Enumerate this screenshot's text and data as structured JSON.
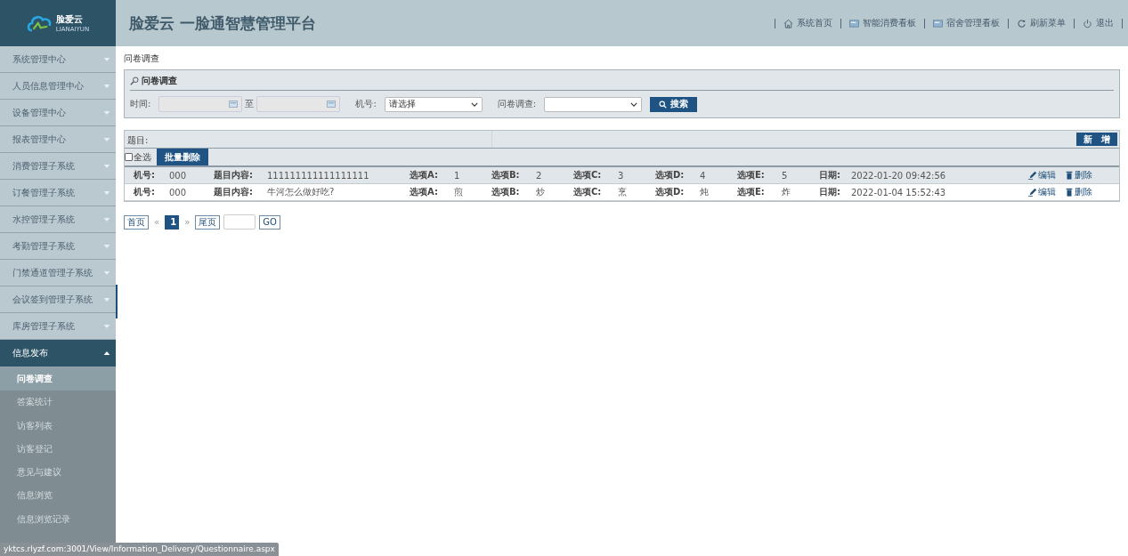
{
  "header": {
    "logo_text": "脸爱云",
    "logo_sub": "LIANAIYUN",
    "title": "脸爱云 一脸通智慧管理平台",
    "nav": [
      {
        "label": "系统首页",
        "kind": "home"
      },
      {
        "label": "智能消费看板",
        "kind": "board"
      },
      {
        "label": "宿舍管理看板",
        "kind": "board"
      },
      {
        "label": "刷新菜单",
        "kind": "refresh"
      },
      {
        "label": "退出",
        "kind": "power"
      }
    ]
  },
  "sidebar": {
    "items": [
      {
        "label": "系统管理中心",
        "expanded": false
      },
      {
        "label": "人员信息管理中心",
        "expanded": false
      },
      {
        "label": "设备管理中心",
        "expanded": false
      },
      {
        "label": "报表管理中心",
        "expanded": false
      },
      {
        "label": "消费管理子系统",
        "expanded": false
      },
      {
        "label": "订餐管理子系统",
        "expanded": false
      },
      {
        "label": "水控管理子系统",
        "expanded": false
      },
      {
        "label": "考勤管理子系统",
        "expanded": false
      },
      {
        "label": "门禁通道管理子系统",
        "expanded": false
      },
      {
        "label": "会议签到管理子系统",
        "expanded": false
      },
      {
        "label": "库房管理子系统",
        "expanded": false
      },
      {
        "label": "信息发布",
        "expanded": true,
        "children": [
          {
            "label": "问卷调查",
            "selected": true
          },
          {
            "label": "答案统计",
            "selected": false
          },
          {
            "label": "访客列表",
            "selected": false
          },
          {
            "label": "访客登记",
            "selected": false
          },
          {
            "label": "意见与建议",
            "selected": false
          },
          {
            "label": "信息浏览",
            "selected": false
          },
          {
            "label": "信息浏览记录",
            "selected": false
          }
        ]
      }
    ]
  },
  "breadcrumb": "问卷调查",
  "search_panel": {
    "title": "问卷调查",
    "time_label": "时间:",
    "to_label": "至",
    "machine_label": "机号:",
    "machine_value": "请选择",
    "survey_label": "问卷调查:",
    "search_button": "搜索"
  },
  "list": {
    "topic_label": "题目:",
    "add_button": "新　增",
    "select_all": {
      "label": "全选",
      "checked": false
    },
    "batch_delete": "批量删除",
    "rows": [
      {
        "highlighted": true,
        "cells": [
          {
            "label": "机号:",
            "value": "000"
          },
          {
            "label": "题目内容:",
            "value": "111111111111111111"
          },
          {
            "label": "选项A:",
            "value": "1"
          },
          {
            "label": "选项B:",
            "value": "2"
          },
          {
            "label": "选项C:",
            "value": "3"
          },
          {
            "label": "选项D:",
            "value": "4"
          },
          {
            "label": "选项E:",
            "value": "5"
          },
          {
            "label": "日期:",
            "value": "2022-01-20 09:42:56"
          }
        ],
        "edit": "编辑",
        "delete": "删除"
      },
      {
        "highlighted": false,
        "cells": [
          {
            "label": "机号:",
            "value": "000"
          },
          {
            "label": "题目内容:",
            "value": "牛河怎么做好吃?"
          },
          {
            "label": "选项A:",
            "value": "煎"
          },
          {
            "label": "选项B:",
            "value": "炒"
          },
          {
            "label": "选项C:",
            "value": "烹"
          },
          {
            "label": "选项D:",
            "value": "炖"
          },
          {
            "label": "选项E:",
            "value": "炸"
          },
          {
            "label": "日期:",
            "value": "2022-01-04 15:52:43"
          }
        ],
        "edit": "编辑",
        "delete": "删除"
      }
    ]
  },
  "pagination": {
    "first": "首页",
    "prev": "«",
    "pages": [
      {
        "label": "1",
        "selected": true
      }
    ],
    "next": "»",
    "last": "尾页",
    "go": "GO"
  },
  "status_url": "yktcs.rlyzf.com:3001/View/Information_Delivery/Questionnaire.aspx"
}
